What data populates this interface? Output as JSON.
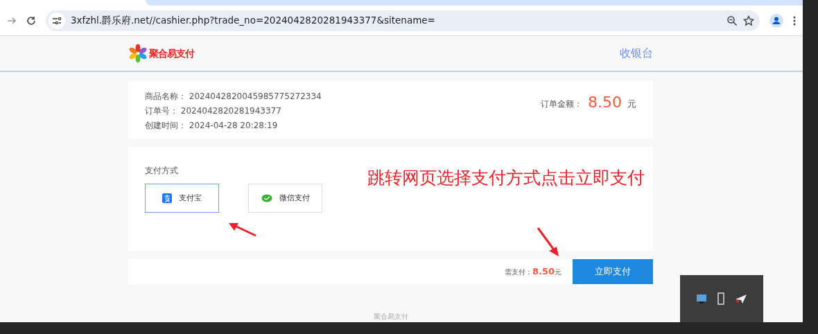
{
  "browser": {
    "url": "3xfzhl.爵乐府.net//cashier.php?trade_no=2024042820281943377&sitename="
  },
  "header": {
    "logo_text": "聚合易支付",
    "title": "收银台"
  },
  "order": {
    "fields": [
      {
        "label": "商品名称：",
        "value": "2024042820045985775272334"
      },
      {
        "label": "订单号：",
        "value": "2024042820281943377"
      },
      {
        "label": "创建时间：",
        "value": "2024-04-28 20:28:19"
      }
    ],
    "amount_label": "订单金额：",
    "amount": "8.50",
    "currency": "元"
  },
  "payment": {
    "heading": "支付方式",
    "methods": [
      {
        "kind": "alipay",
        "label": "支付宝",
        "selected": true
      },
      {
        "kind": "wechat",
        "label": "微信支付",
        "selected": false
      }
    ]
  },
  "pay_bar": {
    "label": "需支付：",
    "amount": "8.50",
    "currency": "元",
    "button": "立即支付"
  },
  "site_footer": "聚合易支付",
  "annotation": {
    "text": "跳转网页选择支付方式点击立即支付"
  }
}
